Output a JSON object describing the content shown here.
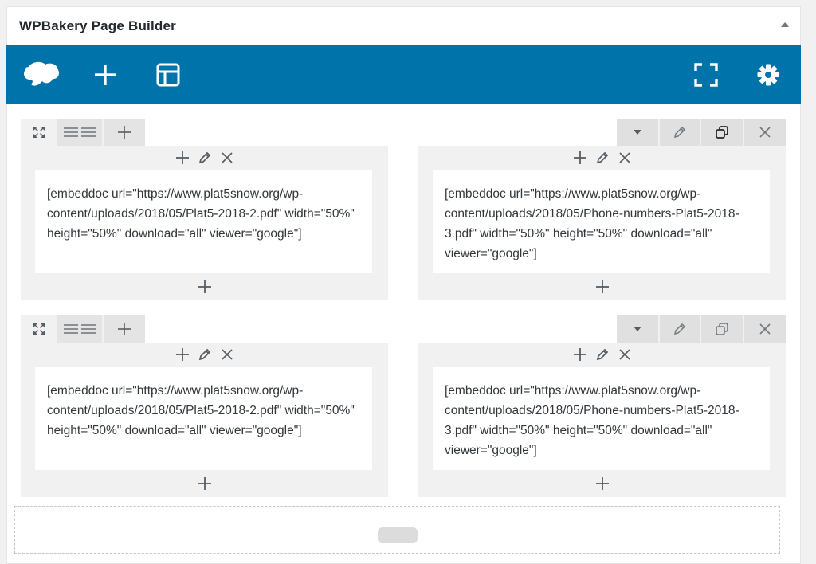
{
  "panel": {
    "title": "WPBakery Page Builder"
  },
  "toolbar": {
    "icons": [
      "wpbakery-logo-icon",
      "add-element-icon",
      "templates-icon",
      "fullscreen-icon",
      "settings-icon"
    ],
    "color": "#0073aa"
  },
  "rows": [
    {
      "columns": [
        {
          "content": "[embeddoc url=\"https://www.plat5snow.org/wp-content/uploads/2018/05/Plat5-2018-2.pdf\" width=\"50%\" height=\"50%\" download=\"all\" viewer=\"google\"]"
        },
        {
          "content": "[embeddoc url=\"https://www.plat5snow.org/wp-content/uploads/2018/05/Phone-numbers-Plat5-2018-3.pdf\" width=\"50%\" height=\"50%\" download=\"all\" viewer=\"google\"]"
        }
      ]
    },
    {
      "columns": [
        {
          "content": "[embeddoc url=\"https://www.plat5snow.org/wp-content/uploads/2018/05/Plat5-2018-2.pdf\" width=\"50%\" height=\"50%\" download=\"all\" viewer=\"google\"]"
        },
        {
          "content": "[embeddoc url=\"https://www.plat5snow.org/wp-content/uploads/2018/05/Phone-numbers-Plat5-2018-3.pdf\" width=\"50%\" height=\"50%\" download=\"all\" viewer=\"google\"]"
        }
      ]
    }
  ],
  "colors": {
    "accent": "#0073aa",
    "active_clone_icon": "#23282d",
    "icon_grey": "#72777c"
  }
}
